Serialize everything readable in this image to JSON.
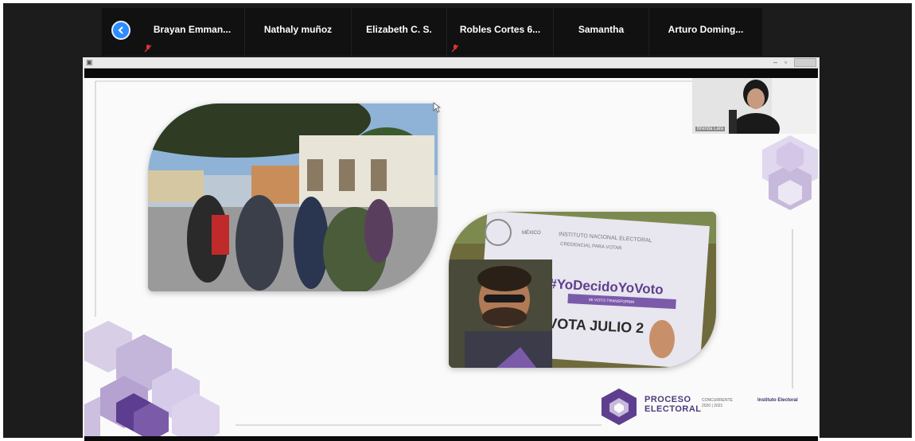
{
  "participants": [
    {
      "name": "Brayan  Emman...",
      "muted": true
    },
    {
      "name": "Nathaly muñoz",
      "muted": false
    },
    {
      "name": "Elizabeth C. S.",
      "muted": false
    },
    {
      "name": "Robles Cortes 6...",
      "muted": true
    },
    {
      "name": "Samantha",
      "muted": false
    },
    {
      "name": "Arturo Doming...",
      "muted": false
    }
  ],
  "presenter": {
    "name": "Brenda Lara"
  },
  "slide": {
    "photo2": {
      "card_title": "INSTITUTO NACIONAL ELECTORAL",
      "card_subtitle": "CREDENCIAL PARA VOTAR",
      "country": "MÉXICO",
      "hashtag": "#YoDecidoYoVoto",
      "tagline": "MI VOTO TRANSFORMA",
      "vote_text": "VOTA JULIO 2"
    },
    "logo": {
      "line1": "PROCESO",
      "line2": "ELECTORAL",
      "concurrente": "CONCURRENTE",
      "years": "2020 | 2021",
      "institute": "Instituto Electoral"
    }
  },
  "colors": {
    "accent": "#2d8cff",
    "purple": "#5e3f8f",
    "lavender": "#c7b9dc"
  }
}
